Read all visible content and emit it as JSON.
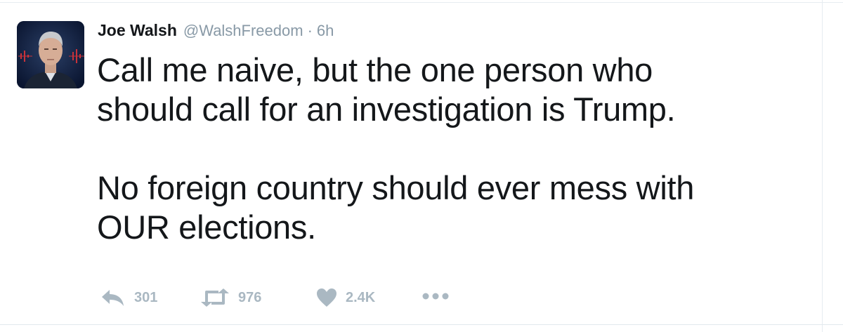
{
  "tweet": {
    "author_name": "Joe Walsh",
    "handle": "@WalshFreedom",
    "separator": "·",
    "time": "6h",
    "text": "Call me naive, but the one person who\nshould call for an investigation is Trump.\n\nNo foreign country should ever mess with\nOUR elections."
  },
  "actions": {
    "reply_count": "301",
    "retweet_count": "976",
    "like_count": "2.4K",
    "reply_icon": "reply-icon",
    "retweet_icon": "retweet-icon",
    "like_icon": "heart-icon",
    "more_icon": "more-icon"
  },
  "colors": {
    "text": "#14171a",
    "secondary": "#8899a6",
    "action": "#aab8c2",
    "divider": "#e6ecf0"
  }
}
